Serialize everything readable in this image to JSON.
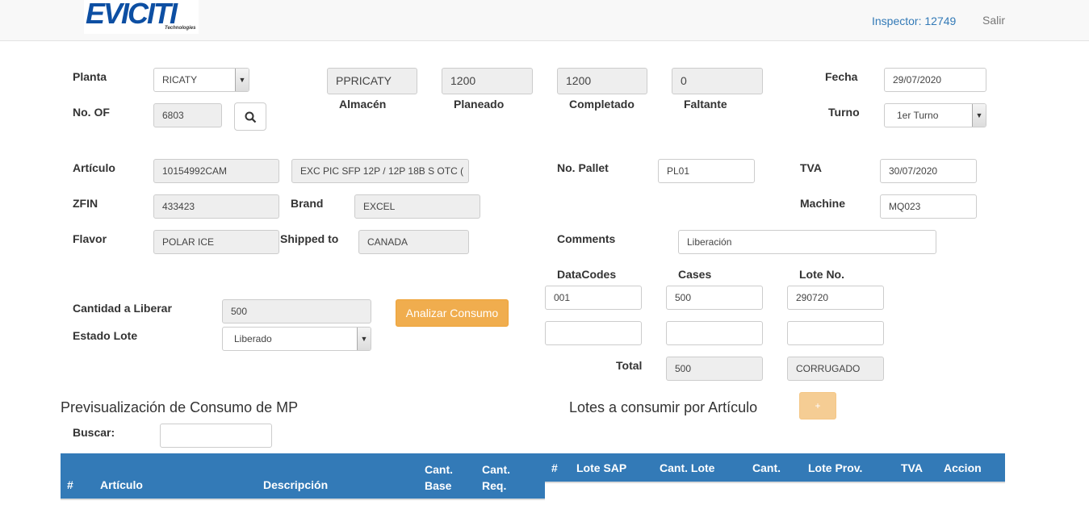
{
  "header": {
    "logo_text": "EVICITI",
    "logo_sub": "Technologies",
    "inspector": "Inspector: 12749",
    "logout": "Salir"
  },
  "form": {
    "planta_label": "Planta",
    "planta_value": "RICATY",
    "no_of_label": "No. OF",
    "no_of_value": "6803",
    "almacen_value": "PPRICATY",
    "almacen_label": "Almacén",
    "planeado_value": "1200",
    "planeado_label": "Planeado",
    "completado_value": "1200",
    "completado_label": "Completado",
    "faltante_value": "0",
    "faltante_label": "Faltante",
    "fecha_label": "Fecha",
    "fecha_value": "29/07/2020",
    "turno_label": "Turno",
    "turno_value": "1er Turno",
    "articulo_label": "Artículo",
    "articulo_value": "10154992CAM",
    "articulo_desc": "EXC PIC SFP 12P / 12P 18B S OTC (",
    "zfin_label": "ZFIN",
    "zfin_value": "433423",
    "brand_label": "Brand",
    "brand_value": "EXCEL",
    "flavor_label": "Flavor",
    "flavor_value": "POLAR ICE",
    "shipped_label": "Shipped to",
    "shipped_value": "CANADA",
    "pallet_label": "No. Pallet",
    "pallet_value": "PL01",
    "tva_label": "TVA",
    "tva_value": "30/07/2020",
    "machine_label": "Machine",
    "machine_value": "MQ023",
    "comments_label": "Comments",
    "comments_value": "Liberación",
    "datacodes_label": "DataCodes",
    "cases_label": "Cases",
    "lote_label": "Lote No.",
    "rows": [
      {
        "datacode": "001",
        "cases": "500",
        "lote": "290720"
      },
      {
        "datacode": "",
        "cases": "",
        "lote": ""
      }
    ],
    "total_label": "Total",
    "total_value": "500",
    "total_lote": "CORRUGADO",
    "cantidad_label": "Cantidad a Liberar",
    "cantidad_value": "500",
    "estado_label": "Estado Lote",
    "estado_value": "Liberado",
    "analizar_button": "Analizar Consumo"
  },
  "preview": {
    "title": "Previsualización de Consumo de MP",
    "search_label": "Buscar:",
    "search_value": "",
    "columns": [
      "#",
      "Artículo",
      "Descripción",
      "Cant.\nBase",
      "Cant.\nReq."
    ]
  },
  "lotes": {
    "title": "Lotes a consumir por Artículo",
    "add_button": "+",
    "columns": [
      "#",
      "Lote SAP",
      "Cant. Lote",
      "Cant.",
      "Lote Prov.",
      "TVA",
      "Accion"
    ]
  },
  "colors": {
    "primary": "#337ab7",
    "warning": "#f0ad4e",
    "readonly_bg": "#eeeeee"
  }
}
